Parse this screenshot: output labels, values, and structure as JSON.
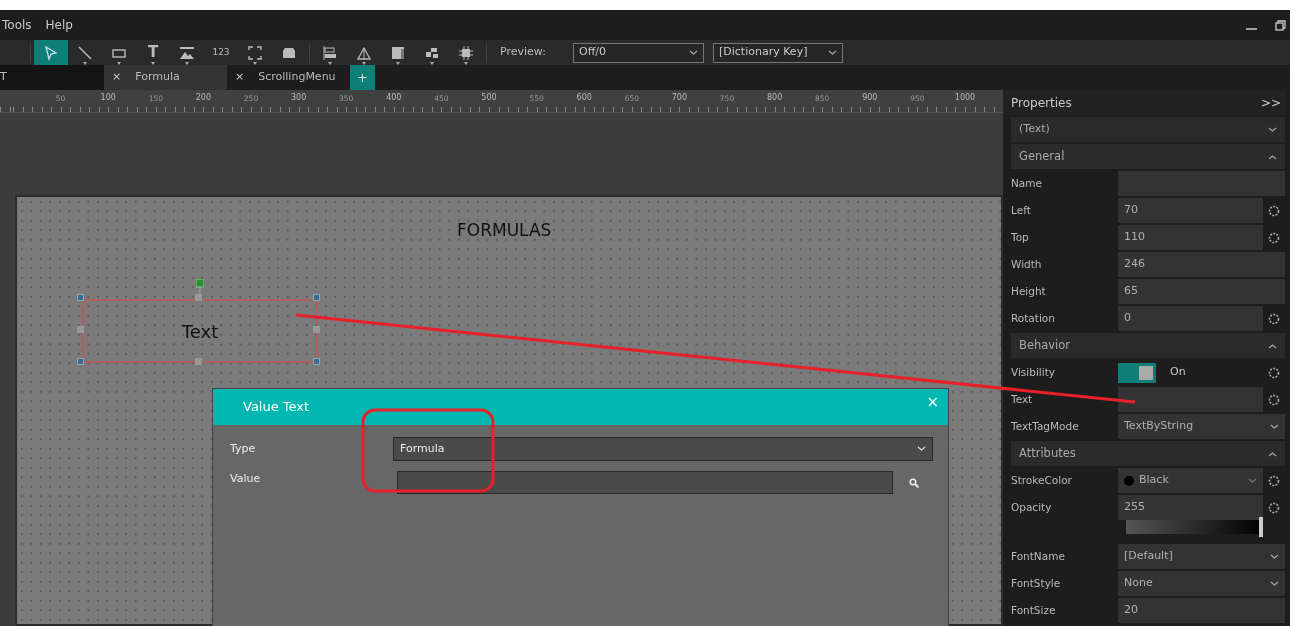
{
  "menu": [
    "Tools",
    "Help"
  ],
  "toolbar": {
    "tools": [
      {
        "kind": "pointer",
        "selected": true,
        "dropdown": false
      },
      {
        "kind": "line",
        "selected": false,
        "dropdown": true
      },
      {
        "kind": "rect",
        "selected": false,
        "dropdown": true
      },
      {
        "kind": "text",
        "label": "T",
        "selected": false,
        "dropdown": true
      },
      {
        "kind": "image",
        "selected": false,
        "dropdown": true
      },
      {
        "kind": "number",
        "label": "123",
        "selected": false,
        "dropdown": false
      },
      {
        "kind": "frame",
        "selected": false,
        "dropdown": true
      },
      {
        "kind": "box",
        "selected": false,
        "dropdown": false
      },
      {
        "kind": "separator"
      },
      {
        "kind": "align",
        "selected": false,
        "dropdown": true
      },
      {
        "kind": "triangle",
        "selected": false,
        "dropdown": true
      },
      {
        "kind": "panel",
        "selected": false,
        "dropdown": true
      },
      {
        "kind": "blocks",
        "selected": false,
        "dropdown": true
      },
      {
        "kind": "chip",
        "selected": false,
        "dropdown": true
      },
      {
        "kind": "separator"
      }
    ],
    "preview_label": "Preview:",
    "preview": "Off/0",
    "dictionary": "[Dictionary Key]"
  },
  "tabs": [
    {
      "label": "T",
      "selected": false
    },
    {
      "label": "Formula",
      "selected": true,
      "close": "×"
    },
    {
      "label": "ScrollingMenu",
      "selected": false,
      "close": "×"
    }
  ],
  "add_tab": "+",
  "ruler": [
    "50",
    "100",
    "150",
    "200",
    "250",
    "300",
    "350",
    "400",
    "450",
    "500",
    "550",
    "600",
    "650",
    "700",
    "750",
    "800",
    "850",
    "900",
    "950",
    "1000"
  ],
  "canvas": {
    "title": "FORMULAS",
    "element": {
      "text": "Text",
      "selected": true
    }
  },
  "dialog": {
    "title": "Value Text",
    "close": "×",
    "type_label": "Type",
    "type": "Formula",
    "value_label": "Value"
  },
  "properties": {
    "title": "Properties",
    "collapse": ">>",
    "object": "(Text)",
    "sections": [
      {
        "title": "General",
        "expanded": true,
        "rows": [
          {
            "kind": "input",
            "label": "Name",
            "value": "",
            "bindable": false
          },
          {
            "kind": "input",
            "label": "Left",
            "value": "70",
            "bindable": true
          },
          {
            "kind": "input",
            "label": "Top",
            "value": "110",
            "bindable": true
          },
          {
            "kind": "input",
            "label": "Width",
            "value": "246",
            "bindable": false
          },
          {
            "kind": "input",
            "label": "Height",
            "value": "65",
            "bindable": false
          },
          {
            "kind": "input",
            "label": "Rotation",
            "value": "0",
            "bindable": true
          }
        ]
      },
      {
        "title": "Behavior",
        "expanded": true,
        "rows": [
          {
            "kind": "toggle",
            "label": "Visibility",
            "value": "On",
            "on": true,
            "bindable": true
          },
          {
            "kind": "input",
            "label": "Text",
            "value": "",
            "bindable": true
          },
          {
            "kind": "select",
            "label": "TextTagMode",
            "value": "TextByString",
            "bindable": false
          }
        ]
      },
      {
        "title": "Attributes",
        "expanded": true,
        "rows": [
          {
            "kind": "color",
            "label": "StrokeColor",
            "value": "Black",
            "color": "#000000",
            "bindable": true
          },
          {
            "kind": "input",
            "label": "Opacity",
            "value": "255",
            "bindable": true
          },
          {
            "kind": "slider",
            "level": 1
          },
          {
            "kind": "select",
            "label": "FontName",
            "value": "[Default]",
            "bindable": false
          },
          {
            "kind": "select",
            "label": "FontStyle",
            "value": "None",
            "bindable": false
          },
          {
            "kind": "input",
            "label": "FontSize",
            "value": "20",
            "bindable": false
          }
        ]
      }
    ]
  }
}
